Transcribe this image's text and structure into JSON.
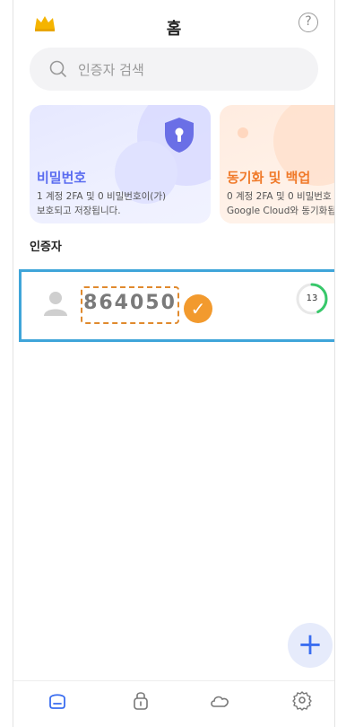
{
  "header": {
    "title": "홈",
    "help_symbol": "?",
    "crown_icon": "crown-icon"
  },
  "search": {
    "placeholder": "인증자 검색"
  },
  "cards": {
    "password": {
      "title": "비밀번호",
      "line1": "1 계정 2FA 및 0 비밀번호이(가)",
      "line2": "보호되고 저장됩니다.",
      "title_color": "#5a6cf0",
      "icon": "shield-keyhole-icon"
    },
    "sync": {
      "title": "동기화 및 백업",
      "line1": "0 계정 2FA 및 0 비밀번호",
      "line2": "Google Cloud와 동기화됩",
      "title_color": "#f07a2a"
    }
  },
  "section": {
    "authenticators": "인증자"
  },
  "authenticator": {
    "code": "864050",
    "timer": "13",
    "timer_fraction": 0.43,
    "verified_icon": "check-icon",
    "accent": "#3fa5d9"
  },
  "fab": {
    "label": "+"
  },
  "tabs": [
    {
      "name": "home",
      "icon": "home-icon",
      "active": true
    },
    {
      "name": "password",
      "icon": "lock-icon",
      "active": false
    },
    {
      "name": "cloud",
      "icon": "cloud-icon",
      "active": false
    },
    {
      "name": "settings",
      "icon": "gear-icon",
      "active": false
    }
  ],
  "colors": {
    "primary": "#3a6df0",
    "orange": "#f29a2e",
    "green": "#37c86a"
  }
}
